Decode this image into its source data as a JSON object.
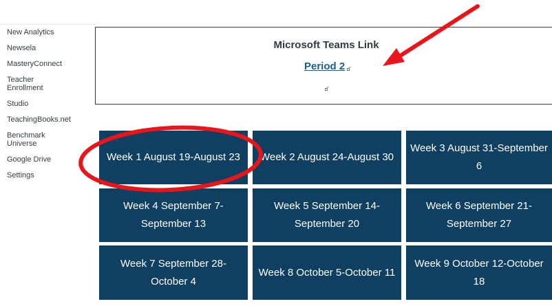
{
  "sidebar": {
    "items": [
      {
        "label": "New Analytics"
      },
      {
        "label": "Newsela"
      },
      {
        "label": "MasteryConnect"
      },
      {
        "label": "Teacher Enrollment"
      },
      {
        "label": "Studio"
      },
      {
        "label": "TeachingBooks.net"
      },
      {
        "label": "Benchmark Universe"
      },
      {
        "label": "Google Drive"
      },
      {
        "label": "Settings"
      }
    ]
  },
  "teams": {
    "title": "Microsoft Teams Link",
    "link_label": "Period 2"
  },
  "weeks": [
    {
      "label": "Week 1 August 19-August 23"
    },
    {
      "label": "Week 2 August 24-August 30"
    },
    {
      "label": "Week 3 August 31-September 6"
    },
    {
      "label": "Week 4 September 7-September 13"
    },
    {
      "label": "Week 5 September 14-September 20"
    },
    {
      "label": "Week 6 September 21-September 27"
    },
    {
      "label": "Week 7 September 28-October 4"
    },
    {
      "label": "Week 8 October 5-October 11"
    },
    {
      "label": "Week 9 October 12-October 18"
    }
  ],
  "colors": {
    "tile_bg": "#0f3f61",
    "link": "#1a5e98",
    "annotation": "#e8161b"
  },
  "icons": [
    "external-link-icon",
    "annotation-arrow",
    "annotation-circle"
  ]
}
